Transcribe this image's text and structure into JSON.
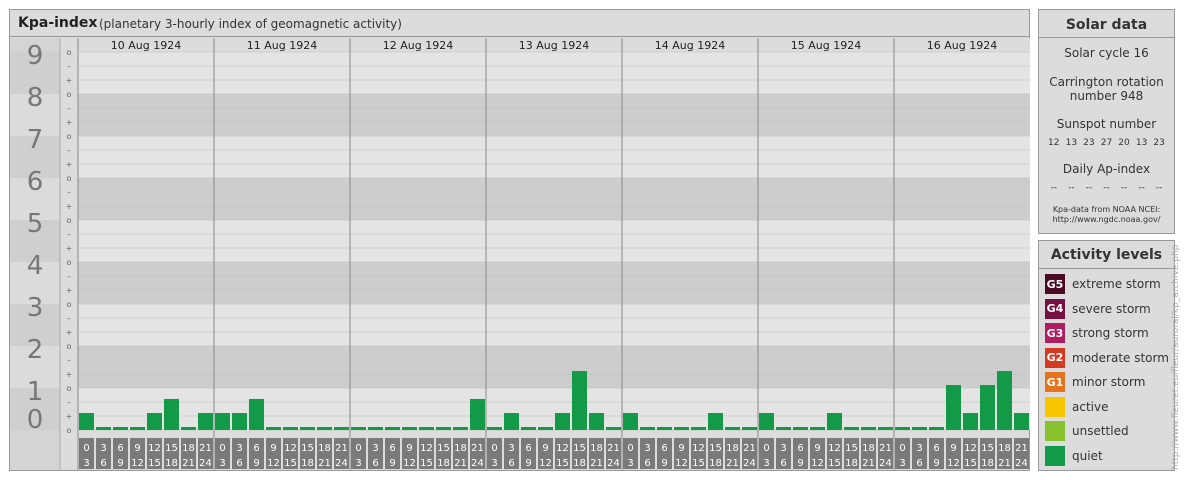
{
  "header": {
    "title": "Kpa-index",
    "subtitle": "(planetary 3-hourly index of geomagnetic activity)"
  },
  "chart_data": {
    "type": "bar",
    "title": "Kpa-index",
    "ylim": [
      0,
      9
    ],
    "y_tick_labels": [
      "0",
      "1",
      "2",
      "3",
      "4",
      "5",
      "6",
      "7",
      "8",
      "9"
    ],
    "sub_tick_labels": [
      "o",
      "–",
      "+"
    ],
    "days": [
      "10 Aug 1924",
      "11 Aug 1924",
      "12 Aug 1924",
      "13 Aug 1924",
      "14 Aug 1924",
      "15 Aug 1924",
      "16 Aug 1924"
    ],
    "interval_labels": [
      {
        "start": "0",
        "end": "3"
      },
      {
        "start": "3",
        "end": "6"
      },
      {
        "start": "6",
        "end": "9"
      },
      {
        "start": "9",
        "end": "12"
      },
      {
        "start": "12",
        "end": "15"
      },
      {
        "start": "15",
        "end": "18"
      },
      {
        "start": "18",
        "end": "21"
      },
      {
        "start": "21",
        "end": "24"
      }
    ],
    "values": [
      [
        0.333,
        0,
        0,
        0,
        0.333,
        0.667,
        0,
        0.333
      ],
      [
        0.333,
        0.333,
        0.667,
        0,
        0,
        0,
        0,
        0
      ],
      [
        0,
        0,
        0,
        0,
        0,
        0,
        0,
        0.667
      ],
      [
        0,
        0.333,
        0,
        0,
        0.333,
        1.333,
        0.333,
        0
      ],
      [
        0.333,
        0,
        0,
        0,
        0,
        0.333,
        0,
        0
      ],
      [
        0.333,
        0,
        0,
        0,
        0.333,
        0,
        0,
        0
      ],
      [
        0,
        0,
        0,
        1,
        0.333,
        1,
        1.333,
        0.333
      ]
    ],
    "bar_color": "#139a46"
  },
  "solar": {
    "title": "Solar data",
    "cycle": "Solar cycle 16",
    "carrington_line1": "Carrington rotation",
    "carrington_line2": "number 948",
    "sunspot_title": "Sunspot number",
    "sunspot_values": [
      "12",
      "13",
      "23",
      "27",
      "20",
      "13",
      "23"
    ],
    "ap_title": "Daily Ap-index",
    "ap_values": [
      "--",
      "--",
      "--",
      "--",
      "--",
      "--",
      "--"
    ],
    "credit_line1": "Kpa-data from NOAA NCEI:",
    "credit_line2": "http://www.ngdc.noaa.gov/"
  },
  "activity": {
    "title": "Activity levels",
    "levels": [
      {
        "code": "G5",
        "label": "extreme storm",
        "color": "#4a0a26"
      },
      {
        "code": "G4",
        "label": "severe storm",
        "color": "#761040"
      },
      {
        "code": "G3",
        "label": "strong storm",
        "color": "#ae1d62"
      },
      {
        "code": "G2",
        "label": "moderate storm",
        "color": "#d43a20"
      },
      {
        "code": "G1",
        "label": "minor storm",
        "color": "#e4731c"
      },
      {
        "code": "",
        "label": "active",
        "color": "#f6c500"
      },
      {
        "code": "",
        "label": "unsettled",
        "color": "#88c12e"
      },
      {
        "code": "",
        "label": "quiet",
        "color": "#139a46"
      }
    ]
  },
  "side_credit": "http://www.fleuret.eu/fleur/auroral/kp_archive.php"
}
